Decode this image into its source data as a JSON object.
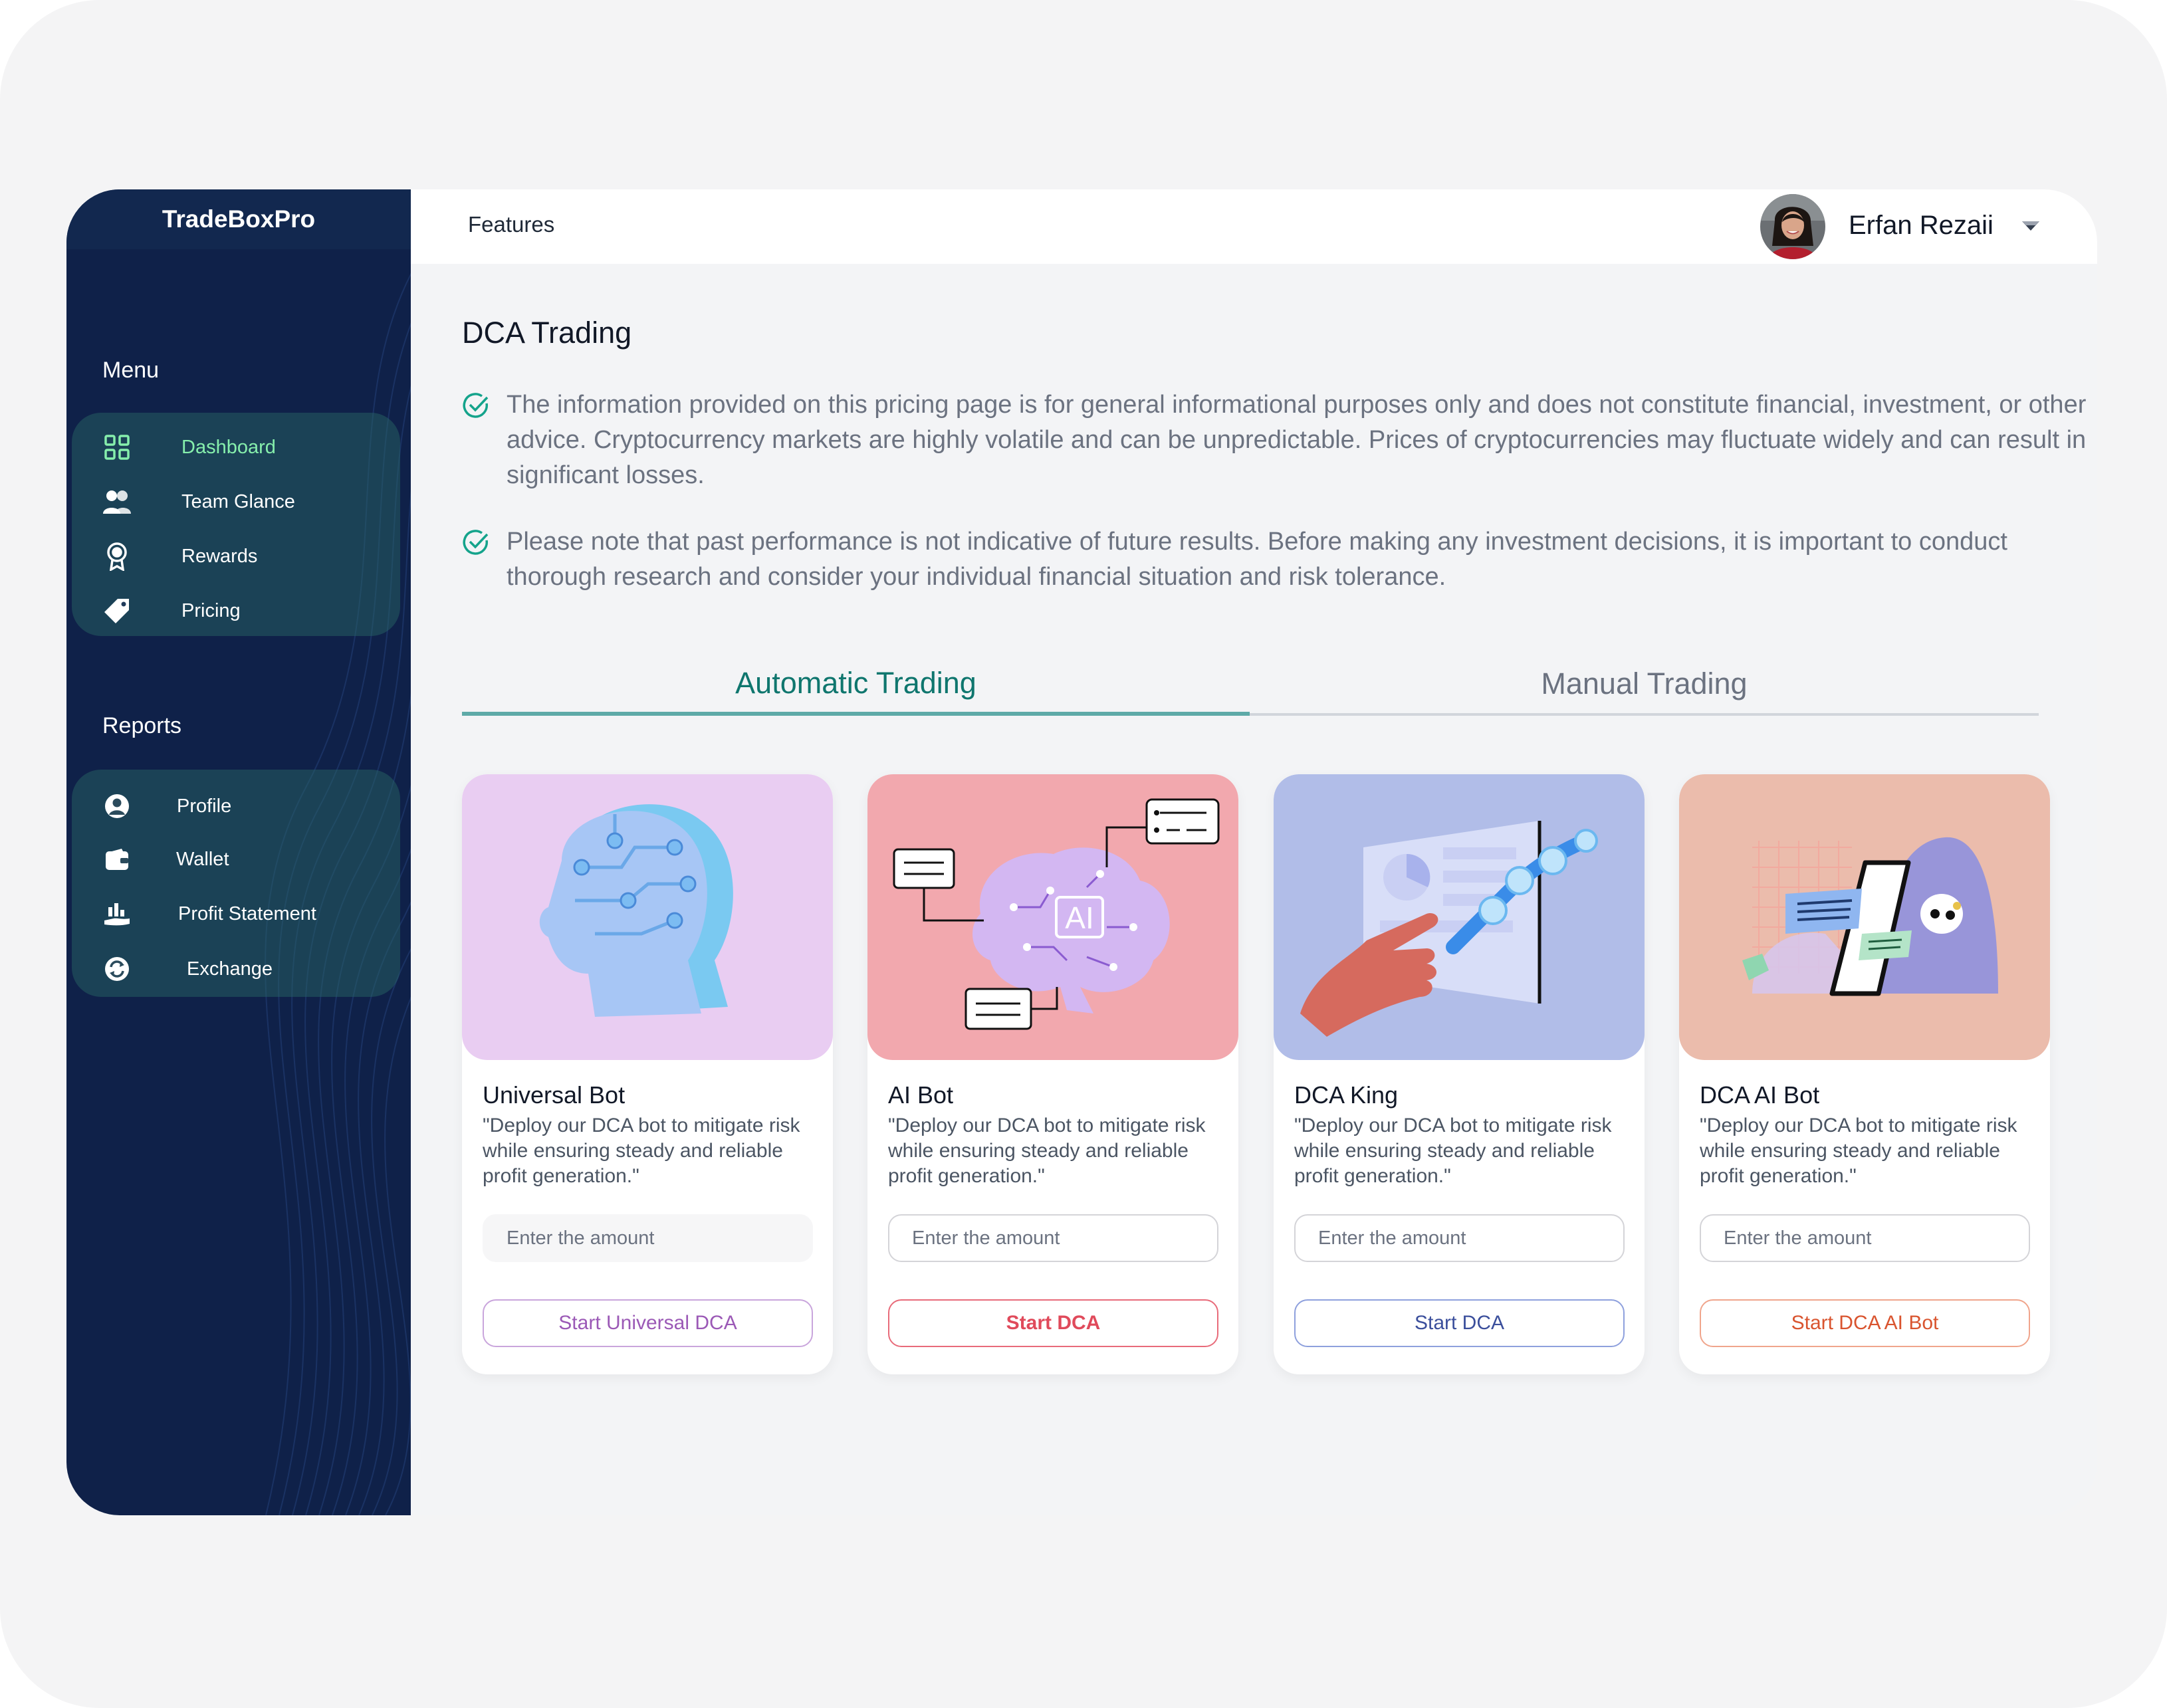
{
  "app": {
    "brand": "TradeBoxPro"
  },
  "sidebar": {
    "menu_label": "Menu",
    "menu_items": [
      {
        "label": "Dashboard",
        "icon": "dashboard-grid-icon",
        "active": true
      },
      {
        "label": "Team Glance",
        "icon": "team-icon",
        "active": false
      },
      {
        "label": "Rewards",
        "icon": "award-badge-icon",
        "active": false
      },
      {
        "label": "Pricing",
        "icon": "price-tag-icon",
        "active": false
      }
    ],
    "reports_label": "Reports",
    "report_items": [
      {
        "label": "Profile",
        "icon": "user-circle-icon"
      },
      {
        "label": "Wallet",
        "icon": "wallet-icon"
      },
      {
        "label": "Profit Statement",
        "icon": "profit-hand-icon"
      },
      {
        "label": "Exchange",
        "icon": "exchange-icon"
      }
    ]
  },
  "header": {
    "title": "Features",
    "user_name": "Erfan Rezaii"
  },
  "main": {
    "page_title": "DCA Trading",
    "notices": [
      "The information provided on this pricing page is for general informational purposes only and does not constitute financial, investment, or other advice. Cryptocurrency markets are highly volatile and can be unpredictable. Prices of cryptocurrencies may fluctuate widely and can result in significant losses.",
      "Please note that past performance is not indicative of future results. Before making any investment decisions, it is important to conduct thorough research and consider your individual financial situation and risk tolerance."
    ],
    "tabs": [
      {
        "label": "Automatic Trading",
        "active": true
      },
      {
        "label": "Manual Trading",
        "active": false
      }
    ],
    "cards": [
      {
        "title": "Universal Bot",
        "description": "\"Deploy our DCA bot to mitigate risk while ensuring steady and reliable profit generation.\"",
        "input_placeholder": "Enter the amount",
        "button_label": "Start Universal DCA",
        "art_bg": "#e9cdf2",
        "button_color": "#9b59b6"
      },
      {
        "title": "AI Bot",
        "description": "\"Deploy our DCA bot to mitigate risk while ensuring steady and reliable profit generation.\"",
        "input_placeholder": "Enter the amount",
        "button_label": "Start DCA",
        "art_bg": "#f2a8ae",
        "button_color": "#e04a5b"
      },
      {
        "title": "DCA King",
        "description": "\"Deploy our DCA bot to mitigate risk while ensuring steady and reliable profit generation.\"",
        "input_placeholder": "Enter the amount",
        "button_label": "Start DCA",
        "art_bg": "#b1bde8",
        "button_color": "#3b4f9c"
      },
      {
        "title": "DCA AI Bot",
        "description": "\"Deploy our DCA bot to mitigate risk while ensuring steady and reliable profit generation.\"",
        "input_placeholder": "Enter the amount",
        "button_label": "Start DCA AI Bot",
        "art_bg": "#ebbcac",
        "button_color": "#d9542f"
      }
    ]
  }
}
